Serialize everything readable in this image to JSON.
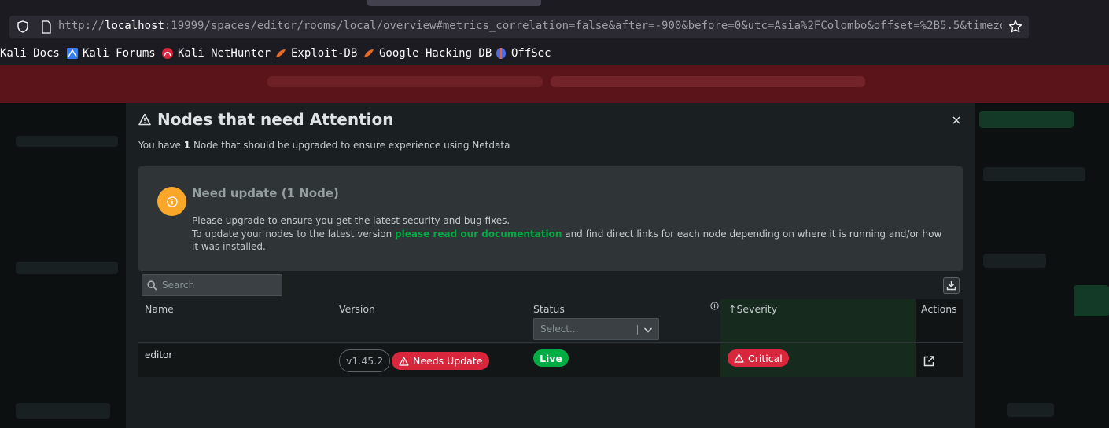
{
  "browser": {
    "url_scheme": "http://",
    "url_host": "localhost",
    "url_rest": ":19999/spaces/editor/rooms/local/overview#metrics_correlation=false&after=-900&before=0&utc=Asia%2FColombo&offset=%2B5.5&timezone",
    "bookmarks": [
      {
        "label": "Kali Docs",
        "icon": "kali-icon"
      },
      {
        "label": "Kali Forums",
        "icon": "kali-forums-icon"
      },
      {
        "label": "Kali NetHunter",
        "icon": "nethunter-icon"
      },
      {
        "label": "Exploit-DB",
        "icon": "exploitdb-icon"
      },
      {
        "label": "Google Hacking DB",
        "icon": "ghdb-icon"
      },
      {
        "label": "OffSec",
        "icon": "offsec-icon"
      }
    ]
  },
  "modal": {
    "title": "Nodes that need Attention",
    "subtitle_pre": "You have ",
    "subtitle_count": "1",
    "subtitle_post": " Node that should be upgraded to ensure experience using Netdata",
    "info": {
      "heading": "Need update (1 Node)",
      "line1": "Please upgrade to ensure you get the latest security and bug fixes.",
      "line2_pre": "To update your nodes to the latest version ",
      "line2_link": "please read our documentation",
      "line2_post": " and find direct links for each node depending on where it is running and/or how it was installed."
    },
    "search_placeholder": "Search",
    "table": {
      "columns": {
        "name": "Name",
        "version": "Version",
        "status": "Status",
        "severity": "Severity",
        "severity_sort": "↑",
        "actions": "Actions"
      },
      "status_filter_placeholder": "Select...",
      "rows": [
        {
          "name": "editor",
          "version": "v1.45.2",
          "version_badge": "Needs Update",
          "status": "Live",
          "severity": "Critical"
        }
      ]
    }
  },
  "colors": {
    "accent_green": "#00ab44",
    "danger_red": "#d8263d",
    "warning_orange": "#f9a629"
  }
}
